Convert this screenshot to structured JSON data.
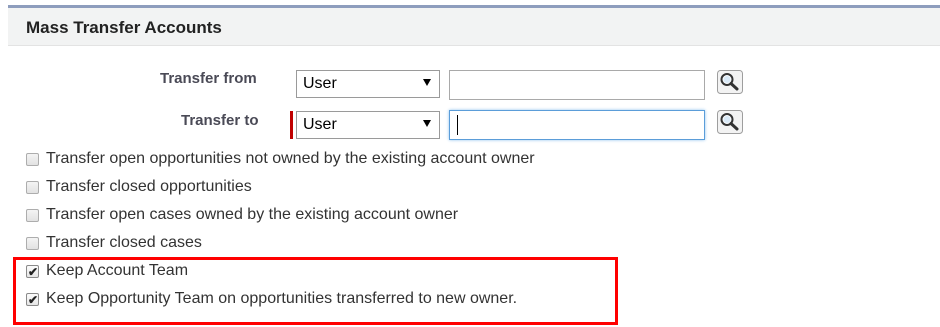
{
  "panel": {
    "title": "Mass Transfer Accounts"
  },
  "transfer_from": {
    "label": "Transfer from",
    "select_value": "User",
    "input_value": ""
  },
  "transfer_to": {
    "label": "Transfer to",
    "select_value": "User",
    "input_value": "",
    "required": true
  },
  "options": [
    {
      "label": "Transfer open opportunities not owned by the existing account owner",
      "checked": false
    },
    {
      "label": "Transfer closed opportunities",
      "checked": false
    },
    {
      "label": "Transfer open cases owned by the existing account owner",
      "checked": false
    },
    {
      "label": "Transfer closed cases",
      "checked": false
    },
    {
      "label": "Keep Account Team",
      "checked": true
    },
    {
      "label": "Keep Opportunity Team on opportunities transferred to new owner.",
      "checked": true
    }
  ],
  "icons": {
    "lookup": "magnifier-lookup-icon",
    "dropdown": "dropdown-arrow-icon",
    "check": "checkmark-icon"
  },
  "colors": {
    "required_marker": "#c00000",
    "annotation_highlight": "#ff0000",
    "header_border": "#8e9dbd"
  }
}
